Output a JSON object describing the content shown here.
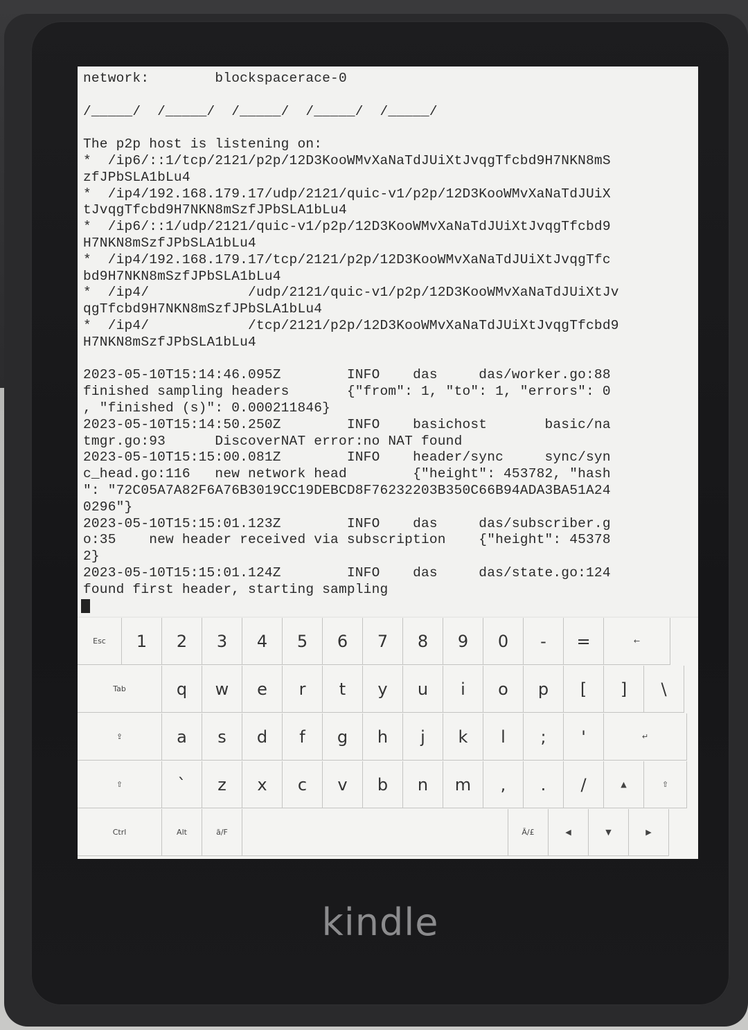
{
  "device": {
    "brand": "kindle"
  },
  "terminal": {
    "lines": [
      "network:        blockspacerace-0",
      "",
      "/_____/  /_____/  /_____/  /_____/  /_____/",
      "",
      "The p2p host is listening on:",
      "*  /ip6/::1/tcp/2121/p2p/12D3KooWMvXaNaTdJUiXtJvqgTfcbd9H7NKN8mS",
      "zfJPbSLA1bLu4",
      "*  /ip4/192.168.179.17/udp/2121/quic-v1/p2p/12D3KooWMvXaNaTdJUiX",
      "tJvqgTfcbd9H7NKN8mSzfJPbSLA1bLu4",
      "*  /ip6/::1/udp/2121/quic-v1/p2p/12D3KooWMvXaNaTdJUiXtJvqgTfcbd9",
      "H7NKN8mSzfJPbSLA1bLu4",
      "*  /ip4/192.168.179.17/tcp/2121/p2p/12D3KooWMvXaNaTdJUiXtJvqgTfc",
      "bd9H7NKN8mSzfJPbSLA1bLu4",
      "*  /ip4/            /udp/2121/quic-v1/p2p/12D3KooWMvXaNaTdJUiXtJv",
      "qgTfcbd9H7NKN8mSzfJPbSLA1bLu4",
      "*  /ip4/            /tcp/2121/p2p/12D3KooWMvXaNaTdJUiXtJvqgTfcbd9",
      "H7NKN8mSzfJPbSLA1bLu4",
      "",
      "2023-05-10T15:14:46.095Z        INFO    das     das/worker.go:88",
      "finished sampling headers       {\"from\": 1, \"to\": 1, \"errors\": 0",
      ", \"finished (s)\": 0.000211846}",
      "2023-05-10T15:14:50.250Z        INFO    basichost       basic/na",
      "tmgr.go:93      DiscoverNAT error:no NAT found",
      "2023-05-10T15:15:00.081Z        INFO    header/sync     sync/syn",
      "c_head.go:116   new network head        {\"height\": 453782, \"hash",
      "\": \"72C05A7A82F6A76B3019CC19DEBCD8F76232203B350C66B94ADA3BA51A24",
      "0296\"}",
      "2023-05-10T15:15:01.123Z        INFO    das     das/subscriber.g",
      "o:35    new header received via subscription    {\"height\": 45378",
      "2}",
      "2023-05-10T15:15:01.124Z        INFO    das     das/state.go:124",
      "found first header, starting sampling"
    ]
  },
  "keyboard": {
    "rows": [
      [
        {
          "label": "Esc",
          "name": "key-esc",
          "size": "small"
        },
        {
          "label": "1",
          "name": "key-1"
        },
        {
          "label": "2",
          "name": "key-2"
        },
        {
          "label": "3",
          "name": "key-3"
        },
        {
          "label": "4",
          "name": "key-4"
        },
        {
          "label": "5",
          "name": "key-5"
        },
        {
          "label": "6",
          "name": "key-6"
        },
        {
          "label": "7",
          "name": "key-7"
        },
        {
          "label": "8",
          "name": "key-8"
        },
        {
          "label": "9",
          "name": "key-9"
        },
        {
          "label": "0",
          "name": "key-0"
        },
        {
          "label": "-",
          "name": "key-minus"
        },
        {
          "label": "=",
          "name": "key-equals"
        },
        {
          "label": "←",
          "name": "key-backspace",
          "size": "small"
        }
      ],
      [
        {
          "label": "Tab",
          "name": "key-tab",
          "size": "small"
        },
        {
          "label": "q",
          "name": "key-q"
        },
        {
          "label": "w",
          "name": "key-w"
        },
        {
          "label": "e",
          "name": "key-e"
        },
        {
          "label": "r",
          "name": "key-r"
        },
        {
          "label": "t",
          "name": "key-t"
        },
        {
          "label": "y",
          "name": "key-y"
        },
        {
          "label": "u",
          "name": "key-u"
        },
        {
          "label": "i",
          "name": "key-i"
        },
        {
          "label": "o",
          "name": "key-o"
        },
        {
          "label": "p",
          "name": "key-p"
        },
        {
          "label": "[",
          "name": "key-left-bracket"
        },
        {
          "label": "]",
          "name": "key-right-bracket"
        },
        {
          "label": "\\",
          "name": "key-backslash"
        }
      ],
      [
        {
          "label": "⇪",
          "name": "key-capslock",
          "size": "small"
        },
        {
          "label": "a",
          "name": "key-a"
        },
        {
          "label": "s",
          "name": "key-s"
        },
        {
          "label": "d",
          "name": "key-d"
        },
        {
          "label": "f",
          "name": "key-f"
        },
        {
          "label": "g",
          "name": "key-g"
        },
        {
          "label": "h",
          "name": "key-h"
        },
        {
          "label": "j",
          "name": "key-j"
        },
        {
          "label": "k",
          "name": "key-k"
        },
        {
          "label": "l",
          "name": "key-l"
        },
        {
          "label": ";",
          "name": "key-semicolon"
        },
        {
          "label": "'",
          "name": "key-quote"
        },
        {
          "label": "↵",
          "name": "key-enter",
          "size": "small"
        }
      ],
      [
        {
          "label": "⇧",
          "name": "key-shift-left",
          "size": "small"
        },
        {
          "label": "`",
          "name": "key-backtick"
        },
        {
          "label": "z",
          "name": "key-z"
        },
        {
          "label": "x",
          "name": "key-x"
        },
        {
          "label": "c",
          "name": "key-c"
        },
        {
          "label": "v",
          "name": "key-v"
        },
        {
          "label": "b",
          "name": "key-b"
        },
        {
          "label": "n",
          "name": "key-n"
        },
        {
          "label": "m",
          "name": "key-m"
        },
        {
          "label": ",",
          "name": "key-comma"
        },
        {
          "label": ".",
          "name": "key-period"
        },
        {
          "label": "/",
          "name": "key-slash"
        },
        {
          "label": "▲",
          "name": "key-arrow-up",
          "size": "small"
        },
        {
          "label": "⇧",
          "name": "key-shift-right",
          "size": "small"
        }
      ],
      [
        {
          "label": "Ctrl",
          "name": "key-ctrl",
          "size": "small"
        },
        {
          "label": "Alt",
          "name": "key-alt",
          "size": "small"
        },
        {
          "label": "ā/F",
          "name": "key-fn",
          "size": "small"
        },
        {
          "label": "",
          "name": "key-space"
        },
        {
          "label": "Ā/£",
          "name": "key-symbols",
          "size": "small"
        },
        {
          "label": "◀",
          "name": "key-arrow-left",
          "size": "small"
        },
        {
          "label": "▼",
          "name": "key-arrow-down",
          "size": "small"
        },
        {
          "label": "▶",
          "name": "key-arrow-right",
          "size": "small"
        }
      ]
    ]
  }
}
